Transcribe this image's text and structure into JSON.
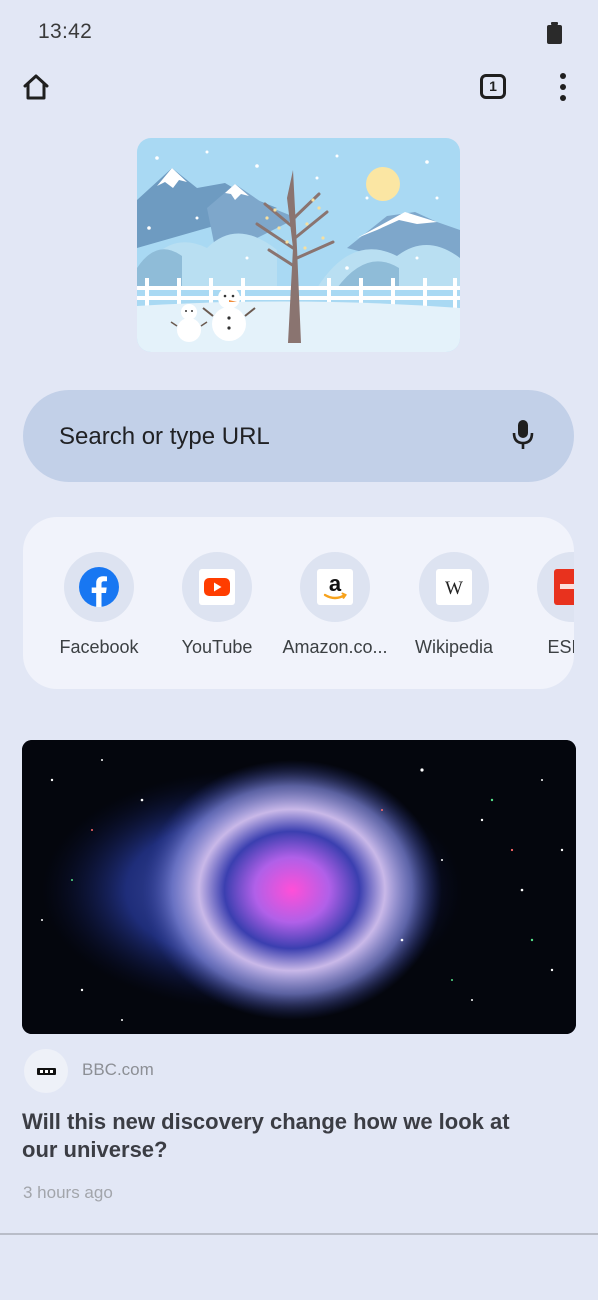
{
  "status_bar": {
    "time": "13:42"
  },
  "toolbar": {
    "tab_count": "1"
  },
  "search": {
    "placeholder": "Search or type URL"
  },
  "shortcuts": [
    {
      "label": "Facebook",
      "icon": "facebook-icon"
    },
    {
      "label": "YouTube",
      "icon": "youtube-icon"
    },
    {
      "label": "Amazon.co...",
      "icon": "amazon-icon"
    },
    {
      "label": "Wikipedia",
      "icon": "wikipedia-icon"
    },
    {
      "label": "ESPN",
      "icon": "espn-icon"
    }
  ],
  "article": {
    "source": "BBC.com",
    "headline": "Will this new discovery change how we look at our universe?",
    "time": "3 hours ago"
  },
  "colors": {
    "background": "#e2e7f5",
    "search_bar": "#c2d0e8",
    "shortcut_panel": "#f1f3fb",
    "facebook_blue": "#1877f2",
    "youtube_red": "#ff3d00",
    "espn_red": "#e8321e"
  }
}
